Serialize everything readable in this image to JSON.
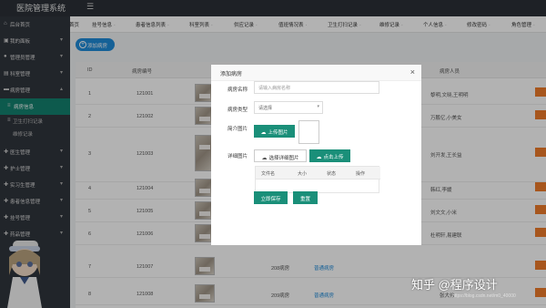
{
  "app": {
    "title": "医院管理系统",
    "menu_icon": "hamburger-icon"
  },
  "sidebar": {
    "items": [
      {
        "label": "后台首页",
        "icon": "home-icon",
        "arrow": ""
      },
      {
        "label": "我的面板",
        "icon": "panel-icon",
        "arrow": "▾"
      },
      {
        "label": "管理员管理",
        "icon": "user-icon",
        "arrow": "▾"
      },
      {
        "label": "科室管理",
        "icon": "folder-icon",
        "arrow": "▾"
      },
      {
        "label": "病房管理",
        "icon": "bed-icon",
        "arrow": "▴"
      },
      {
        "label": "病房信息",
        "icon": "list-icon",
        "arrow": ""
      },
      {
        "label": "卫生打扫记录",
        "icon": "list-icon",
        "arrow": ""
      },
      {
        "label": "维修记录",
        "icon": "",
        "arrow": ""
      },
      {
        "label": "医生管理",
        "icon": "doctor-icon",
        "arrow": "▾"
      },
      {
        "label": "护士管理",
        "icon": "nurse-icon",
        "arrow": "▾"
      },
      {
        "label": "实习生管理",
        "icon": "intern-icon",
        "arrow": "▾"
      },
      {
        "label": "患者信息管理",
        "icon": "patient-icon",
        "arrow": "▾"
      },
      {
        "label": "挂号管理",
        "icon": "register-icon",
        "arrow": "▾"
      },
      {
        "label": "药品管理",
        "icon": "medicine-icon",
        "arrow": "▾"
      }
    ]
  },
  "tabs": [
    "首页",
    "挂号信息",
    "患者信息列表",
    "科室列表",
    "供应记录",
    "值班情况表",
    "卫生打扫记录",
    "维修记录",
    "个人信息",
    "修改密码",
    "角色管理"
  ],
  "toolbar": {
    "add_label": "添加病房",
    "add_icon": "+"
  },
  "table": {
    "headers": {
      "id": "ID",
      "room_no": "病房编号",
      "people": "病房人员"
    },
    "rows": [
      {
        "id": "1",
        "room_no": "121001",
        "name": "",
        "type": "",
        "people": "黎明,文晓,王明明"
      },
      {
        "id": "2",
        "room_no": "121002",
        "name": "",
        "type": "",
        "people": "万鹏亿,小美女"
      },
      {
        "id": "3",
        "room_no": "121003",
        "name": "",
        "type": "",
        "people": "刘开发,王长益"
      },
      {
        "id": "4",
        "room_no": "121004",
        "name": "",
        "type": "",
        "people": "韩红,李媛"
      },
      {
        "id": "5",
        "room_no": "121005",
        "name": "",
        "type": "",
        "people": "刘文文,小米"
      },
      {
        "id": "6",
        "room_no": "121006",
        "name": "",
        "type": "",
        "people": "杜明轩,易建联"
      },
      {
        "id": "7",
        "room_no": "121007",
        "name": "208病房",
        "type": "普通病房",
        "people": ""
      },
      {
        "id": "8",
        "room_no": "121008",
        "name": "209病房",
        "type": "普通病房",
        "people": "张大伟"
      }
    ]
  },
  "modal": {
    "title": "添加病房",
    "close": "×",
    "name_label": "病房名称",
    "name_placeholder": "请输入病房名称",
    "type_label": "病房类型",
    "type_value": "请选择",
    "type_arrow": "▾",
    "brief_label": "简介图片",
    "upload_label": "上传图片",
    "detail_label": "详细图片",
    "choose_label": "选择详细图片",
    "start_upload_label": "点击上传",
    "file_headers": [
      "文件名",
      "大小",
      "状态",
      "操作"
    ],
    "submit_label": "立即保存",
    "reset_label": "重置"
  },
  "watermark": {
    "text": "知乎 @程序设计",
    "url": "https://blog.csdn.net/m0_40000"
  },
  "colors": {
    "accent": "#1a8f79",
    "primary_blue": "#1f8bd8",
    "action_orange": "#f07c2a",
    "sidebar": "#30353d"
  }
}
